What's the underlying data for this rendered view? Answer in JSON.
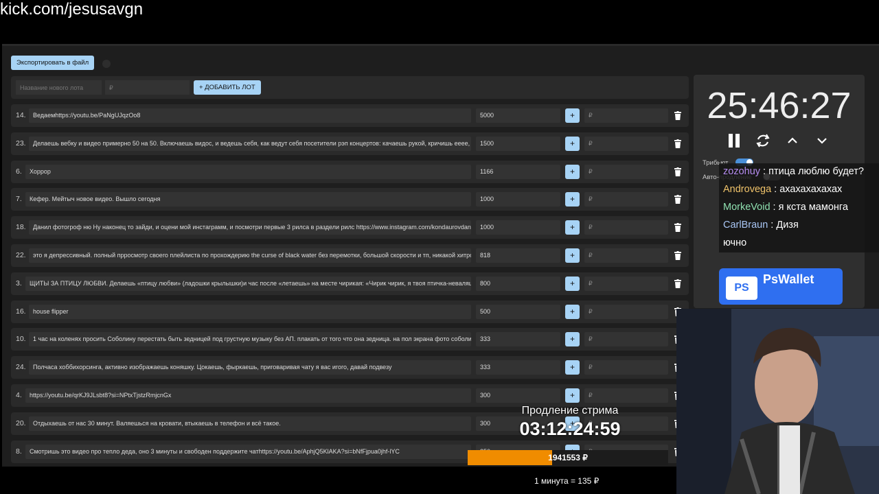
{
  "url": "kick.com/jesusavgn",
  "toolbar": {
    "export_label": "Экспортировать в файл"
  },
  "add_lot": {
    "name_placeholder": "Название нового лота",
    "price_placeholder": "₽",
    "add_label": "+ ДОБАВИТЬ ЛОТ"
  },
  "lots": [
    {
      "num": "14.",
      "title": "Ведаемhttps://youtu.be/PaNgUJqzOo8",
      "amount": "5000",
      "plus": "+",
      "bid": "₽"
    },
    {
      "num": "23.",
      "title": "Делаешь вебку и видео примерно 50 на 50. Включаешь видос, и ведешь себя, как ведут себя посетители рэп концертов: качаешь рукой, кричишь ееее, е",
      "amount": "1500",
      "plus": "+",
      "bid": "₽"
    },
    {
      "num": "6.",
      "title": "Хоррор",
      "amount": "1166",
      "plus": "+",
      "bid": "₽"
    },
    {
      "num": "7.",
      "title": "Кефер. Мейтыч новое видео. Вышло сегодня",
      "amount": "1000",
      "plus": "+",
      "bid": "₽"
    },
    {
      "num": "18.",
      "title": "Данил фотогроф ню Ну наконец то зайди, и оцени мой инстаграмм, и посмотри первые 3 рилса в раздели рилс https://www.instagram.com/kondaurovdany",
      "amount": "1000",
      "plus": "+",
      "bid": "₽"
    },
    {
      "num": "22.",
      "title": "это я депрессивный. полный прросмотр своего плейлиста по прохождерию the curse of black water без перемотки, большой скорости и тп, никакой хитрос",
      "amount": "818",
      "plus": "+",
      "bid": "₽"
    },
    {
      "num": "3.",
      "title": "ЩИТЫ ЗА ПТИЦУ ЛЮБВИ. Делаешь «птицу любви» (ладошки крылышки)и час после «летаешь» на месте чирикая: «Чирик чирик, я твоя птичка-неваляш",
      "amount": "800",
      "plus": "+",
      "bid": "₽"
    },
    {
      "num": "16.",
      "title": "house flipper",
      "amount": "500",
      "plus": "+",
      "bid": "₽"
    },
    {
      "num": "10.",
      "title": "1 час на коленях просить Соболину перестать быть зедницей под грустную музыку без АП. плакать от того что она зедница. на пол экрана фото соболи",
      "amount": "333",
      "plus": "+",
      "bid": "₽"
    },
    {
      "num": "24.",
      "title": "Полчаса хоббихорсинга, активно изображаешь коняшку. Цокаешь, фыркаешь, приговаривая чату я вас игого, давай подвезу",
      "amount": "333",
      "plus": "+",
      "bid": "₽"
    },
    {
      "num": "4.",
      "title": "https://youtu.be/qrKJ9JLsbt8?si=NPtxTjstzRmjcnGx",
      "amount": "300",
      "plus": "+",
      "bid": "₽"
    },
    {
      "num": "20.",
      "title": "Отдыхаешь от нас 30 минут. Валяешься на кровати, втыкаешь в телефон и всё такое.",
      "amount": "300",
      "plus": "+",
      "bid": "₽"
    },
    {
      "num": "8.",
      "title": "Смотришь это видео про тепло деда, оно 3 минуты и свободен поддержите чатhttps://youtu.be/AphjQ5KlAKA?si=bNfFjpua0jhf-lYC",
      "amount": "250",
      "plus": "+",
      "bid": "₽"
    }
  ],
  "timer": {
    "value": "25:46:27"
  },
  "toggles": {
    "tributes_label": "Трибьют",
    "auto_label": "Авто-продление"
  },
  "chat": [
    {
      "user": "zozohuy",
      "sep": " : ",
      "msg": "птица люблю будет?",
      "color": "#b58cf0"
    },
    {
      "user": "Androvega",
      "sep": " : ",
      "msg": "ахахахахахах",
      "color": "#f0c36a"
    },
    {
      "user": "MorkeVoid",
      "sep": " : ",
      "msg": "я кста мамонга",
      "color": "#8fe0b0"
    },
    {
      "user": "CarlBraun",
      "sep": " : ",
      "msg": "Дизя",
      "color": "#a9c6f5"
    },
    {
      "user": "",
      "sep": "",
      "msg": "ючно",
      "color": "#ffffff"
    }
  ],
  "pswallet": {
    "logo": "PS",
    "name": "PsWallet"
  },
  "extension": {
    "label": "Продление стрима",
    "time": "03:12:24:59",
    "total": "1941553 ₽",
    "progress": 0.42,
    "rate": "1 минута = 135 ₽"
  },
  "colors": {
    "accent": "#a7d3f5",
    "progress": "#f08c00",
    "panel": "#2a2a2a"
  }
}
